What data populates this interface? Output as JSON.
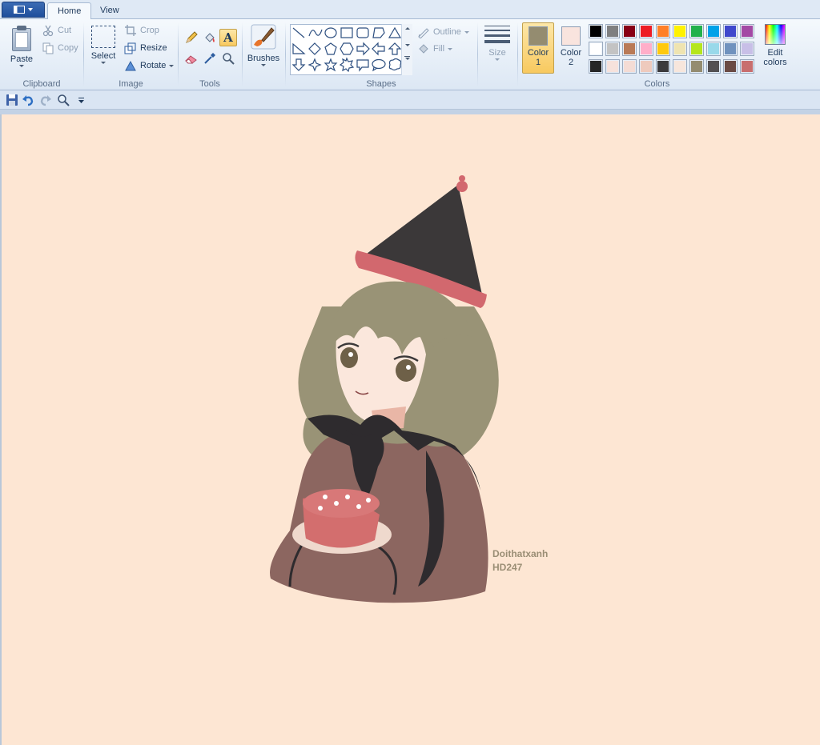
{
  "tabs": [
    {
      "label": "Home",
      "active": true
    },
    {
      "label": "View",
      "active": false
    }
  ],
  "clipboard": {
    "paste_label": "Paste",
    "cut_label": "Cut",
    "copy_label": "Copy",
    "group_label": "Clipboard"
  },
  "image": {
    "select_label": "Select",
    "crop_label": "Crop",
    "resize_label": "Resize",
    "rotate_label": "Rotate",
    "group_label": "Image"
  },
  "tools": {
    "group_label": "Tools",
    "items": [
      "pencil-icon",
      "fill-icon",
      "text-icon",
      "eraser-icon",
      "color-picker-icon",
      "magnifier-icon"
    ],
    "active": "text-icon",
    "text_glyph": "A"
  },
  "brushes": {
    "label": "Brushes"
  },
  "shapes": {
    "group_label": "Shapes",
    "outline_label": "Outline",
    "fill_label": "Fill"
  },
  "size": {
    "label": "Size"
  },
  "colors": {
    "color1_label": "Color",
    "color1_num": "1",
    "color2_label": "Color",
    "color2_num": "2",
    "color1_value": "#948c70",
    "color2_value": "#f9e4de",
    "edit_label": "Edit",
    "edit_label2": "colors",
    "group_label": "Colors",
    "palette": [
      [
        "#000000",
        "#7f7f7f",
        "#880015",
        "#ed1c24",
        "#ff7f27",
        "#fff200",
        "#22b14c",
        "#00a2e8",
        "#3f48cc",
        "#a349a4"
      ],
      [
        "#ffffff",
        "#c3c3c3",
        "#b97a57",
        "#ffaec9",
        "#ffc90e",
        "#efe4b0",
        "#b5e61d",
        "#99d9ea",
        "#7092be",
        "#c8bfe7"
      ],
      [
        "#262626",
        "#f6e2dc",
        "#f4dcd5",
        "#eecabd",
        "#3b3a3c",
        "#f7e6dc",
        "#948c70",
        "#535052",
        "#6a4a44",
        "#c86e6e"
      ]
    ]
  },
  "canvas": {
    "background": "#fde6d3",
    "signature_line1": "Doithatxanh",
    "signature_line2": "HD247"
  }
}
